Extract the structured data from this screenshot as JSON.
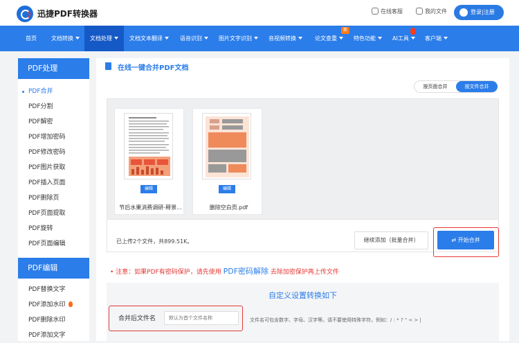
{
  "header": {
    "brand": "迅捷PDF转换器",
    "online_service": "在线客服",
    "my_files": "我的文件",
    "login": "登录|注册"
  },
  "nav": {
    "items": [
      {
        "label": "首页",
        "dropdown": false
      },
      {
        "label": "文档转换",
        "dropdown": true
      },
      {
        "label": "文档处理",
        "dropdown": true,
        "active": true
      },
      {
        "label": "文档文本翻译",
        "dropdown": true
      },
      {
        "label": "语音识别",
        "dropdown": true
      },
      {
        "label": "图片文字识别",
        "dropdown": true
      },
      {
        "label": "音视频转换",
        "dropdown": true
      },
      {
        "label": "论文查重",
        "dropdown": true
      },
      {
        "label": "特色功能",
        "dropdown": true
      },
      {
        "label": "AI工具",
        "dropdown": true
      },
      {
        "label": "客户端",
        "dropdown": true
      }
    ],
    "new_badge": "新"
  },
  "sidebar": {
    "section1_title": "PDF处理",
    "section1_items": [
      "PDF合并",
      "PDF分割",
      "PDF解密",
      "PDF增加密码",
      "PDF修改密码",
      "PDF图片获取",
      "PDF插入页面",
      "PDF删除页",
      "PDF页面提取",
      "PDF旋转",
      "PDF页面编辑"
    ],
    "section2_title": "PDF编辑",
    "section2_items": [
      "PDF替换文字",
      "PDF添加水印",
      "PDF删除水印",
      "PDF添加文字"
    ]
  },
  "main": {
    "title": "在线一键合并PDF文档",
    "mode_page": "按页面合并",
    "mode_file": "按文件合并",
    "files": [
      {
        "name": "节后水果消费调研-释景...",
        "edit": "编辑"
      },
      {
        "name": "删除空白页.pdf",
        "edit": "编辑"
      }
    ],
    "summary": "已上传2个文件，共899.51K。",
    "continue_add": "继续添加（批量合并）",
    "start_merge": "开始合并",
    "notice_prefix": "注意：如果PDF有密码保护，请先使用",
    "notice_link": "PDF密码解除",
    "notice_suffix": "去除加密保护再上传文件",
    "settings_title": "自定义设置转换如下",
    "name_label": "合并后文件名",
    "name_placeholder": "默认为首个文件名称",
    "name_hint": "文件名可包含数字、字母、汉字等。请不要使用特殊字符，例如：/ : * ? \" < > |"
  },
  "colors": {
    "primary": "#2b7de9",
    "nav_active": "#1559c7",
    "highlight_frame": "#e53935",
    "doc_orange": "#ef8a5a"
  },
  "icons": [
    "logo-icon",
    "headset-icon",
    "folder-icon",
    "user-avatar-icon",
    "flame-icon",
    "document-icon",
    "refresh-icon"
  ]
}
